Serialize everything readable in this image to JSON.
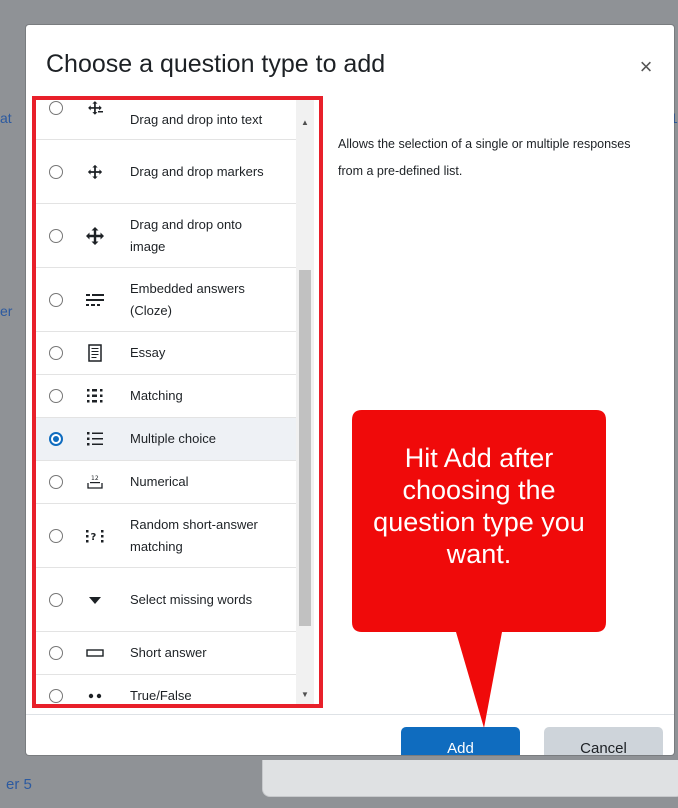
{
  "background": {
    "bottom_left_text": "er 5"
  },
  "dialog": {
    "title": "Choose a question type to add",
    "close_icon": "close-icon",
    "description": "Allows the selection of a single or multiple responses from a pre-defined list.",
    "add_label": "Add",
    "cancel_label": "Cancel"
  },
  "question_types": [
    {
      "label": "Drag and drop into text",
      "icon": "drag-drop-text-icon",
      "selected": false
    },
    {
      "label": "Drag and drop markers",
      "icon": "drag-drop-markers-icon",
      "selected": false
    },
    {
      "label": "Drag and drop onto image",
      "icon": "drag-drop-image-icon",
      "selected": false
    },
    {
      "label": "Embedded answers (Cloze)",
      "icon": "cloze-icon",
      "selected": false
    },
    {
      "label": "Essay",
      "icon": "essay-icon",
      "selected": false
    },
    {
      "label": "Matching",
      "icon": "matching-icon",
      "selected": false
    },
    {
      "label": "Multiple choice",
      "icon": "multiple-choice-icon",
      "selected": true
    },
    {
      "label": "Numerical",
      "icon": "numerical-icon",
      "selected": false
    },
    {
      "label": "Random short-answer matching",
      "icon": "random-short-answer-icon",
      "selected": false
    },
    {
      "label": "Select missing words",
      "icon": "select-missing-words-icon",
      "selected": false
    },
    {
      "label": "Short answer",
      "icon": "short-answer-icon",
      "selected": false
    },
    {
      "label": "True/False",
      "icon": "true-false-icon",
      "selected": false
    }
  ],
  "callout": {
    "text": "Hit Add after choosing the question type you want.",
    "color": "#f00a0a"
  },
  "colors": {
    "primary": "#0f6cbf",
    "highlight_border": "#e8202a"
  }
}
